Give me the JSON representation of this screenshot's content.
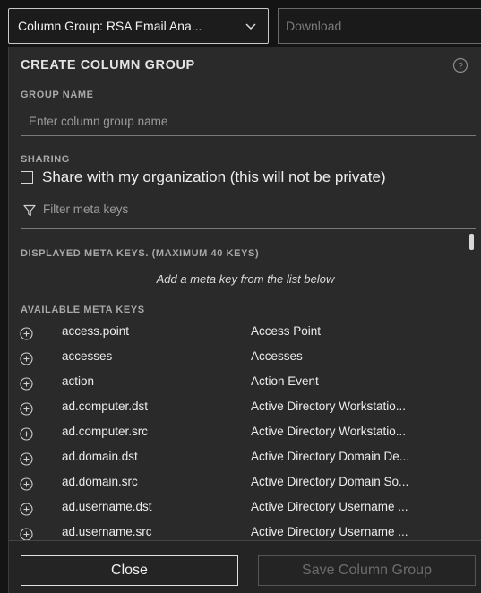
{
  "topbar": {
    "column_group_label": "Column Group: RSA Email Ana...",
    "download_label": "Download"
  },
  "panel": {
    "title": "CREATE COLUMN GROUP",
    "group_name_label": "GROUP NAME",
    "group_name_placeholder": "Enter column group name",
    "sharing_label": "SHARING",
    "share_text": "Share with my organization (this will not be private)",
    "share_checked": false,
    "filter_placeholder": "Filter meta keys",
    "displayed_label": "DISPLAYED META KEYS. (MAXIMUM 40 KEYS)",
    "displayed_hint": "Add a meta key from the list below",
    "available_label": "AVAILABLE META KEYS"
  },
  "meta_keys": [
    {
      "key": "access.point",
      "desc": "Access Point"
    },
    {
      "key": "accesses",
      "desc": "Accesses"
    },
    {
      "key": "action",
      "desc": "Action Event"
    },
    {
      "key": "ad.computer.dst",
      "desc": "Active Directory Workstatio..."
    },
    {
      "key": "ad.computer.src",
      "desc": "Active Directory Workstatio..."
    },
    {
      "key": "ad.domain.dst",
      "desc": "Active Directory Domain De..."
    },
    {
      "key": "ad.domain.src",
      "desc": "Active Directory Domain So..."
    },
    {
      "key": "ad.username.dst",
      "desc": "Active Directory Username ..."
    },
    {
      "key": "ad.username.src",
      "desc": "Active Directory Username ..."
    }
  ],
  "footer": {
    "close_label": "Close",
    "save_label": "Save Column Group"
  },
  "icons": {
    "chevron": "chevron-down-icon",
    "help": "help-circle-icon",
    "filter": "filter-icon",
    "add": "add-circle-icon"
  }
}
